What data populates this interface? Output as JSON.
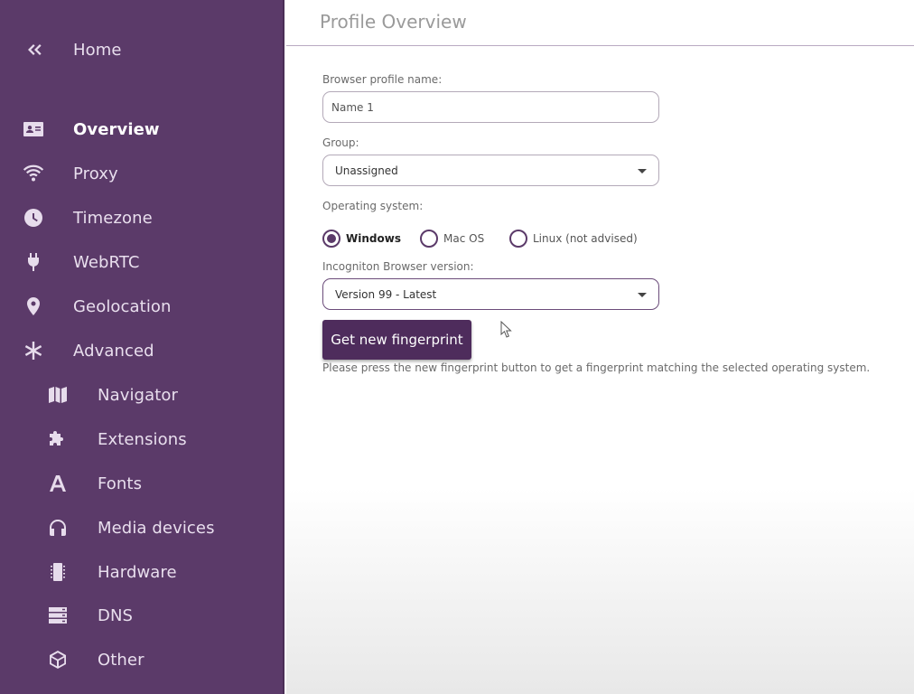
{
  "sidebar": {
    "home": {
      "label": "Home",
      "icon": "double-chevron-left-icon"
    },
    "items": [
      {
        "label": "Overview",
        "icon": "id-card-icon"
      },
      {
        "label": "Proxy",
        "icon": "wifi-icon"
      },
      {
        "label": "Timezone",
        "icon": "clock-icon"
      },
      {
        "label": "WebRTC",
        "icon": "plug-icon"
      },
      {
        "label": "Geolocation",
        "icon": "map-pin-icon"
      },
      {
        "label": "Advanced",
        "icon": "asterisk-icon"
      }
    ],
    "advanced_items": [
      {
        "label": "Navigator",
        "icon": "map-icon"
      },
      {
        "label": "Extensions",
        "icon": "puzzle-icon"
      },
      {
        "label": "Fonts",
        "icon": "font-icon"
      },
      {
        "label": "Media devices",
        "icon": "headphones-icon"
      },
      {
        "label": "Hardware",
        "icon": "chip-icon"
      },
      {
        "label": "DNS",
        "icon": "server-icon"
      },
      {
        "label": "Other",
        "icon": "cube-icon"
      }
    ],
    "active_item": "Overview"
  },
  "main": {
    "title": "Profile Overview",
    "profile_name": {
      "label": "Browser profile name:",
      "value": "Name 1"
    },
    "group": {
      "label": "Group:",
      "value": "Unassigned"
    },
    "os": {
      "label": "Operating system:",
      "options": [
        "Windows",
        "Mac OS",
        "Linux (not advised)"
      ],
      "selected": "Windows"
    },
    "browser_version": {
      "label": "Incogniton Browser version:",
      "value": "Version 99 - Latest"
    },
    "fingerprint_button": "Get new fingerprint",
    "helper_text": "Please press the new fingerprint button to get a fingerprint matching the selected operating system."
  },
  "colors": {
    "sidebar_bg": "#5b3a69",
    "accent": "#4e2c5c",
    "title_text": "#9a9a9a"
  }
}
